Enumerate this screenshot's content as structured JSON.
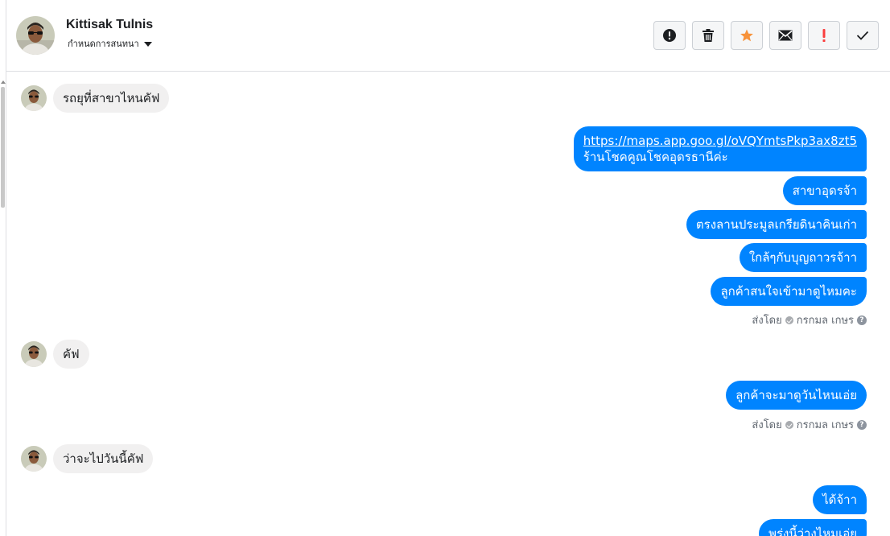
{
  "header": {
    "contact_name": "Kittisak Tulnis",
    "assign_label": "กำหนดการสนทนา"
  },
  "toolbar": {
    "buttons": [
      {
        "name": "spam-button",
        "icon": "alert-circle-icon"
      },
      {
        "name": "delete-button",
        "icon": "trash-icon"
      },
      {
        "name": "star-button",
        "icon": "star-icon",
        "color": "#f7923a"
      },
      {
        "name": "mark-unread-button",
        "icon": "envelope-icon"
      },
      {
        "name": "follow-up-button",
        "icon": "exclamation-icon",
        "color": "#fa3e3e"
      },
      {
        "name": "done-button",
        "icon": "checkmark-icon"
      }
    ]
  },
  "colors": {
    "outgoing_bubble": "#0084ff",
    "incoming_bubble": "#f1f0f0"
  },
  "messages": {
    "m1": "รถยุที่สาขาไหนคัฟ",
    "m2_link": "https://maps.app.goo.gl/oVQYmtsPkp3ax8zt5",
    "m2_text": "ร้านโชคคูณโชคอุดรธานีค่ะ",
    "m3": "สาขาอุดรจ้า",
    "m4": "ตรงลานประมูลเกรียดินาคินเก่า",
    "m5": "ใกล้ๆกับบุญถาวรจ้าา",
    "m6": "ลูกค้าสนใจเข้ามาดูไหมคะ",
    "sent1_prefix": "ส่งโดย",
    "sent1_name": "กรกมล เกษร",
    "m7": "คัฟ",
    "m8": "ลูกค้าจะมาดูวันไหนเอ่ย",
    "sent2_prefix": "ส่งโดย",
    "sent2_name": "กรกมล เกษร",
    "m9": "ว่าจะไปวันนี้คัฟ",
    "m10": "ได้จ้าา",
    "m11": "พรุ่งนี้ว่างไหมเอ่ย"
  }
}
